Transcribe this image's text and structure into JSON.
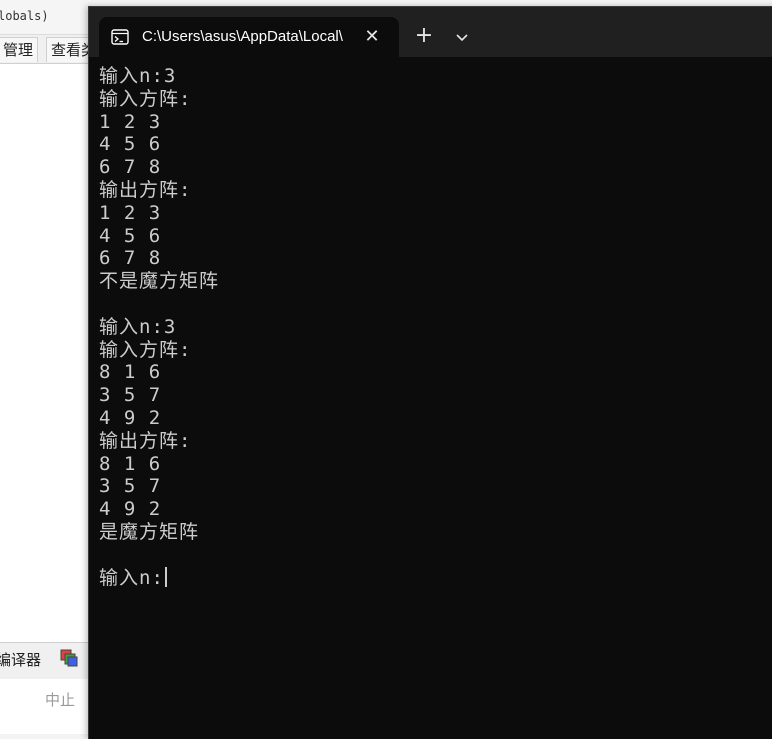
{
  "background_app": {
    "top_text": "lobals)",
    "tabs": [
      {
        "label": "管理"
      },
      {
        "label": "查看类"
      }
    ],
    "compiler_label": "编译器",
    "stop_button": "中止"
  },
  "terminal": {
    "tab_title": "C:\\Users\\asus\\AppData\\Local\\",
    "close_symbol": "✕",
    "new_tab_symbol": "+",
    "lines": [
      "输入n:3",
      "输入方阵:",
      "1 2 3",
      "4 5 6",
      "6 7 8",
      "输出方阵:",
      "1 2 3",
      "4 5 6",
      "6 7 8",
      "不是魔方矩阵",
      "",
      "输入n:3",
      "输入方阵:",
      "8 1 6",
      "3 5 7",
      "4 9 2",
      "输出方阵:",
      "8 1 6",
      "3 5 7",
      "4 9 2",
      "是魔方矩阵",
      ""
    ],
    "prompt": "输入n:"
  },
  "colors": {
    "terminal_bg": "#0c0c0c",
    "titlebar_bg": "#202020",
    "text": "#cccccc"
  }
}
